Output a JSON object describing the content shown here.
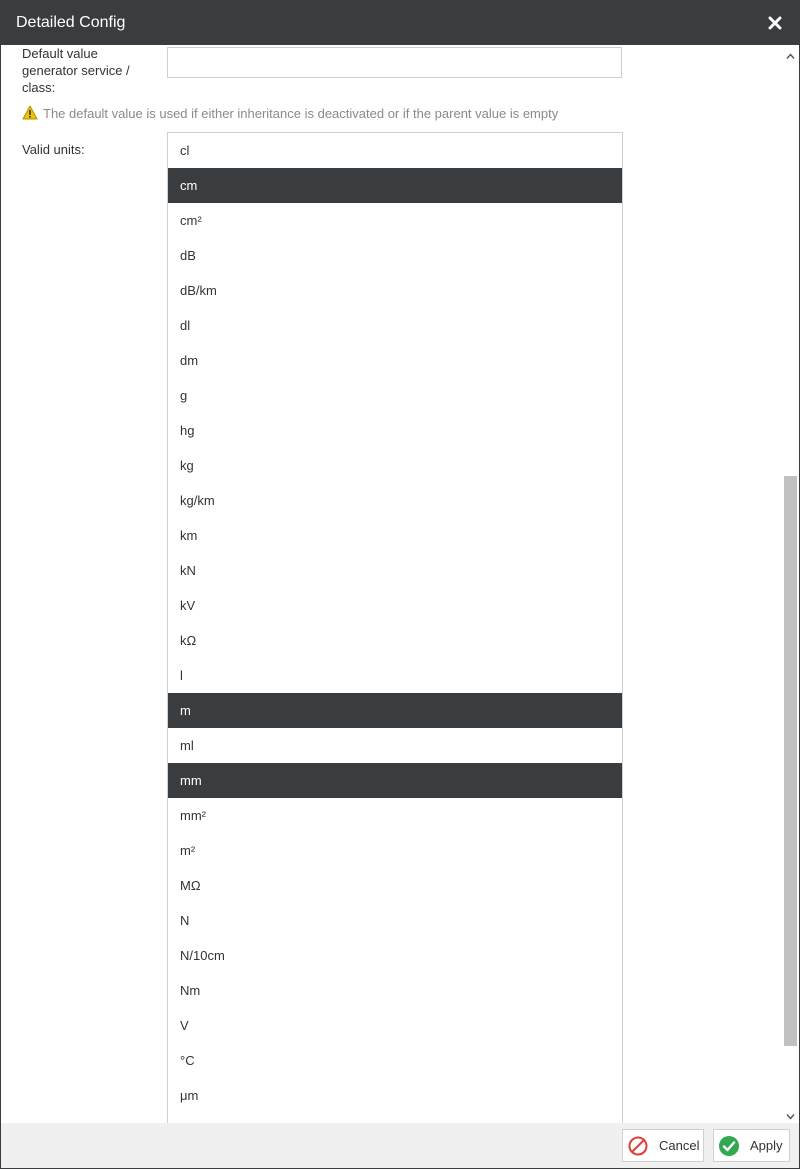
{
  "dialog": {
    "title": "Detailed Config",
    "close_icon": "close-icon"
  },
  "default_value": {
    "label": "Default value generator service / class:",
    "value": "",
    "placeholder": ""
  },
  "warning": {
    "icon": "warning-icon",
    "text": "The default value is used if either inheritance is deactivated or if the parent value is empty"
  },
  "valid_units": {
    "label": "Valid units:",
    "items": [
      {
        "label": "cl",
        "selected": false
      },
      {
        "label": "cm",
        "selected": true
      },
      {
        "label": "cm²",
        "selected": false
      },
      {
        "label": "dB",
        "selected": false
      },
      {
        "label": "dB/km",
        "selected": false
      },
      {
        "label": "dl",
        "selected": false
      },
      {
        "label": "dm",
        "selected": false
      },
      {
        "label": "g",
        "selected": false
      },
      {
        "label": "hg",
        "selected": false
      },
      {
        "label": "kg",
        "selected": false
      },
      {
        "label": "kg/km",
        "selected": false
      },
      {
        "label": "km",
        "selected": false
      },
      {
        "label": "kN",
        "selected": false
      },
      {
        "label": "kV",
        "selected": false
      },
      {
        "label": "kΩ",
        "selected": false
      },
      {
        "label": "l",
        "selected": false
      },
      {
        "label": "m",
        "selected": true
      },
      {
        "label": "ml",
        "selected": false
      },
      {
        "label": "mm",
        "selected": true
      },
      {
        "label": "mm²",
        "selected": false
      },
      {
        "label": "m²",
        "selected": false
      },
      {
        "label": "MΩ",
        "selected": false
      },
      {
        "label": "N",
        "selected": false
      },
      {
        "label": "N/10cm",
        "selected": false
      },
      {
        "label": "Nm",
        "selected": false
      },
      {
        "label": "V",
        "selected": false
      },
      {
        "label": "°C",
        "selected": false
      },
      {
        "label": "μm",
        "selected": false
      }
    ]
  },
  "footer": {
    "cancel_label": "Cancel",
    "apply_label": "Apply"
  },
  "colors": {
    "titlebar": "#3a3d40",
    "selected_row": "#3a3d40",
    "cancel_icon": "#e03c31",
    "apply_icon": "#33a852",
    "warning_icon": "#f2c200"
  }
}
